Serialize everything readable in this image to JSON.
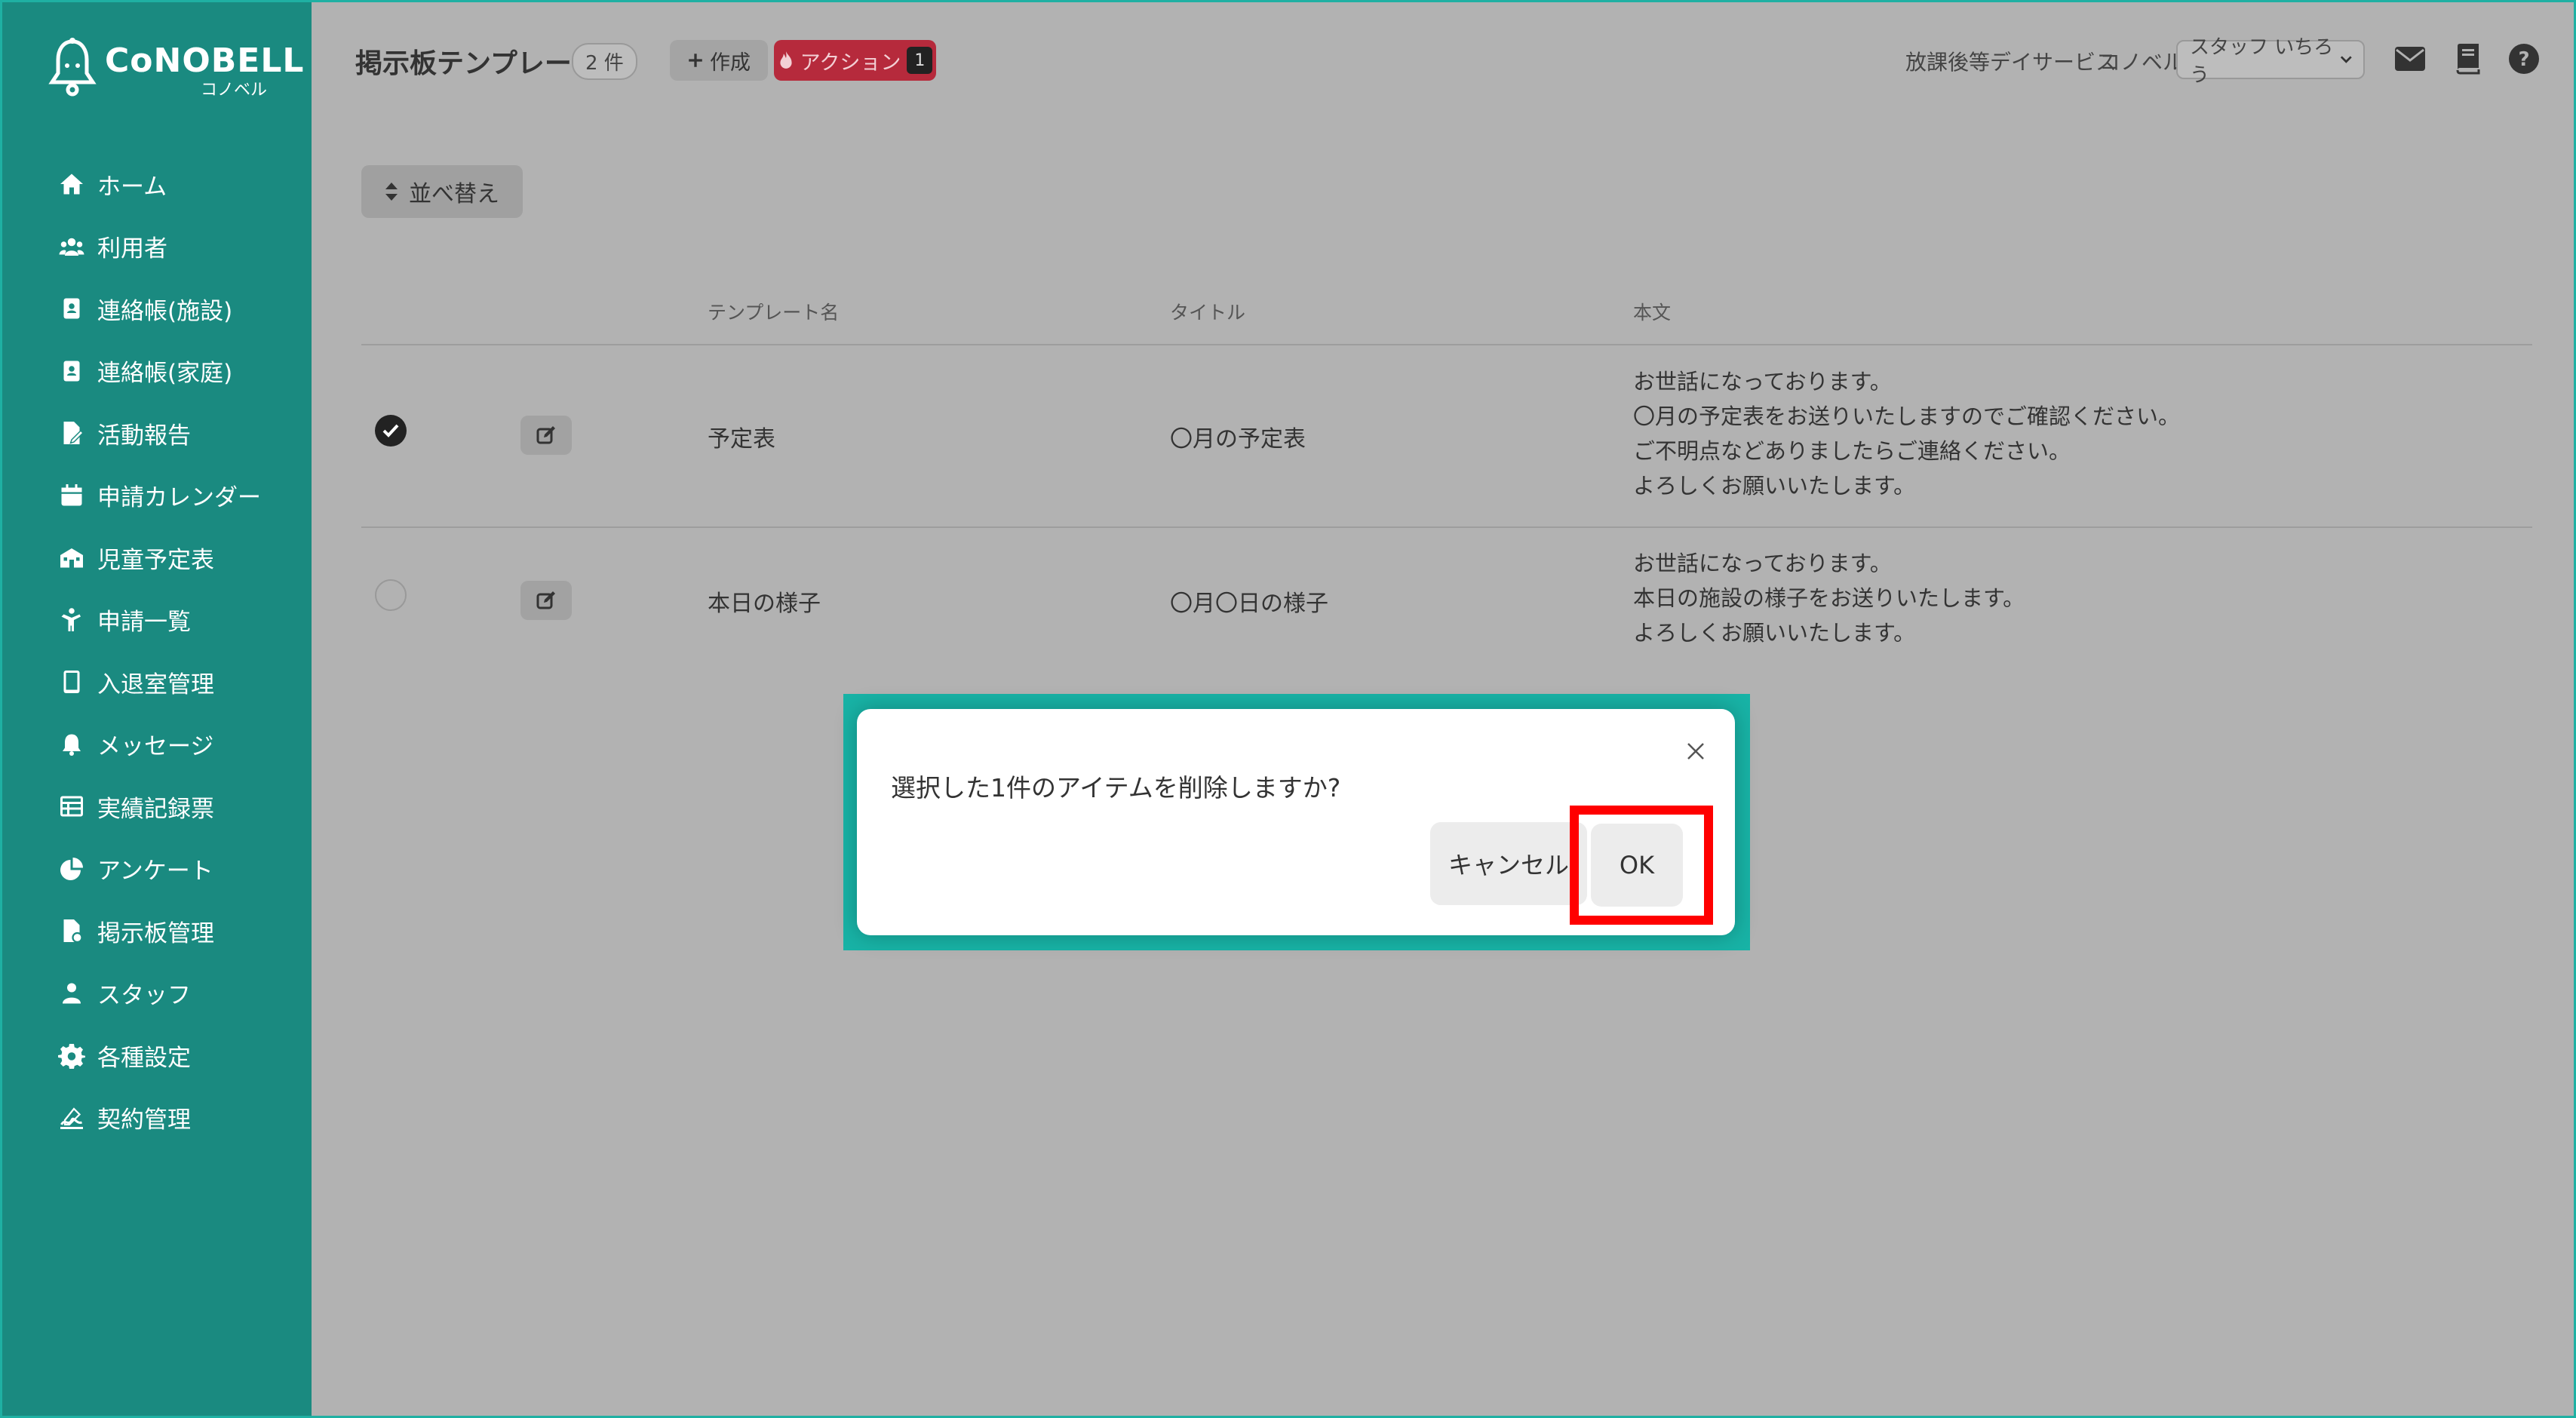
{
  "app": {
    "logo_text": "CoNOBELL",
    "logo_sub": "コノベル",
    "brand_color": "#1a8a80"
  },
  "sidebar": {
    "items": [
      {
        "label": "ホーム",
        "icon": "home-icon"
      },
      {
        "label": "利用者",
        "icon": "users-icon"
      },
      {
        "label": "連絡帳(施設)",
        "icon": "contact-book-icon"
      },
      {
        "label": "連絡帳(家庭)",
        "icon": "contact-book-icon"
      },
      {
        "label": "活動報告",
        "icon": "report-icon"
      },
      {
        "label": "申請カレンダー",
        "icon": "calendar-icon"
      },
      {
        "label": "児童予定表",
        "icon": "school-icon"
      },
      {
        "label": "申請一覧",
        "icon": "child-icon"
      },
      {
        "label": "入退室管理",
        "icon": "tablet-icon"
      },
      {
        "label": "メッセージ",
        "icon": "bell-icon"
      },
      {
        "label": "実績記録票",
        "icon": "table-icon"
      },
      {
        "label": "アンケート",
        "icon": "pie-chart-icon"
      },
      {
        "label": "掲示板管理",
        "icon": "board-icon"
      },
      {
        "label": "スタッフ",
        "icon": "staff-icon"
      },
      {
        "label": "各種設定",
        "icon": "gear-icon"
      },
      {
        "label": "契約管理",
        "icon": "contract-icon"
      }
    ]
  },
  "header": {
    "title": "掲示板テンプレート",
    "count": "2 件",
    "create_label": "作成",
    "action_label": "アクション",
    "action_count": "1",
    "facility": "放課後等デイサービス",
    "org": "コノベル",
    "staff_select": "スタッフ いちろう"
  },
  "toolbar": {
    "sort_label": "並べ替え"
  },
  "table": {
    "headers": [
      "テンプレート名",
      "タイトル",
      "本文"
    ],
    "rows": [
      {
        "checked": true,
        "name": "予定表",
        "title": "〇月の予定表",
        "body": [
          "お世話になっております。",
          "〇月の予定表をお送りいたしますのでご確認ください。",
          "ご不明点などありましたらご連絡ください。",
          "よろしくお願いいたします。"
        ]
      },
      {
        "checked": false,
        "name": "本日の様子",
        "title": "〇月〇日の様子",
        "body": [
          "お世話になっております。",
          "本日の施設の様子をお送りいたします。",
          "よろしくお願いいたします。"
        ]
      }
    ]
  },
  "dialog": {
    "message": "選択した1件のアイテムを削除しますか?",
    "cancel_label": "キャンセル",
    "ok_label": "OK",
    "highlight_color": "#ff0000",
    "frame_color": "#18b3a6"
  }
}
